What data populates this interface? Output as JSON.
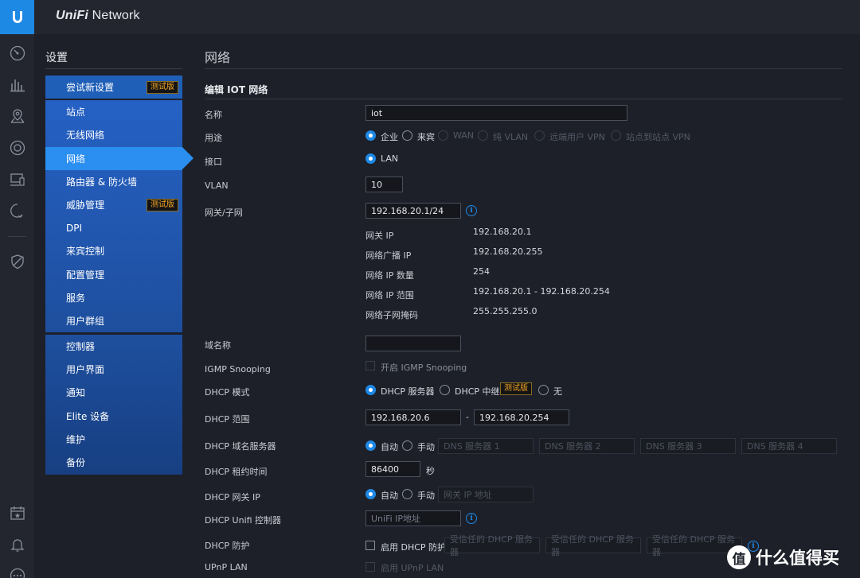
{
  "app": {
    "brand_prefix": "UniFi",
    "brand_suffix": " Network"
  },
  "settings": {
    "title": "设置",
    "try_new": {
      "label": "尝试新设置",
      "badge": "测试版"
    },
    "group1": [
      {
        "label": "站点"
      },
      {
        "label": "无线网络"
      },
      {
        "label": "网络",
        "active": true
      },
      {
        "label": "路由器 & 防火墙"
      },
      {
        "label": "威胁管理",
        "badge": "测试版"
      },
      {
        "label": "DPI"
      },
      {
        "label": "来宾控制"
      },
      {
        "label": "配置管理"
      },
      {
        "label": "服务"
      },
      {
        "label": "用户群组"
      }
    ],
    "group2": [
      {
        "label": "控制器"
      },
      {
        "label": "用户界面"
      },
      {
        "label": "通知"
      },
      {
        "label": "Elite 设备"
      },
      {
        "label": "维护"
      },
      {
        "label": "备份"
      }
    ]
  },
  "page": {
    "title": "网络",
    "section": "编辑 IOT 网络"
  },
  "form": {
    "name": {
      "label": "名称",
      "value": "iot"
    },
    "purpose": {
      "label": "用途",
      "options": [
        "企业",
        "来宾",
        "WAN",
        "纯 VLAN",
        "远端用户 VPN",
        "站点到站点 VPN"
      ],
      "selected": "企业"
    },
    "interface": {
      "label": "接口",
      "value": "LAN"
    },
    "vlan": {
      "label": "VLAN",
      "value": "10"
    },
    "gateway": {
      "label": "网关/子网",
      "value": "192.168.20.1/24",
      "details": [
        {
          "label": "网关 IP",
          "value": "192.168.20.1"
        },
        {
          "label": "网络广播 IP",
          "value": "192.168.20.255"
        },
        {
          "label": "网络 IP 数量",
          "value": "254"
        },
        {
          "label": "网络 IP 范围",
          "value": "192.168.20.1 - 192.168.20.254"
        },
        {
          "label": "网络子网掩码",
          "value": "255.255.255.0"
        }
      ]
    },
    "domain": {
      "label": "域名称",
      "value": ""
    },
    "igmp": {
      "label": "IGMP Snooping",
      "checkbox": "开启 IGMP Snooping"
    },
    "dhcp_mode": {
      "label": "DHCP 模式",
      "options": [
        "DHCP 服务器",
        "DHCP 中继",
        "无"
      ],
      "badge": "测试版",
      "selected": "DHCP 服务器"
    },
    "dhcp_range": {
      "label": "DHCP 范围",
      "start": "192.168.20.6",
      "sep": "-",
      "end": "192.168.20.254"
    },
    "dhcp_dns": {
      "label": "DHCP 域名服务器",
      "options": [
        "自动",
        "手动"
      ],
      "selected": "自动",
      "placeholders": [
        "DNS 服务器 1",
        "DNS 服务器 2",
        "DNS 服务器 3",
        "DNS 服务器 4"
      ]
    },
    "dhcp_lease": {
      "label": "DHCP 租约时间",
      "value": "86400",
      "unit": "秒"
    },
    "dhcp_gateway": {
      "label": "DHCP 网关 IP",
      "options": [
        "自动",
        "手动"
      ],
      "selected": "自动",
      "placeholder": "网关 IP 地址"
    },
    "dhcp_unifi": {
      "label": "DHCP Unifi 控制器",
      "placeholder": "UniFi IP地址"
    },
    "dhcp_guard": {
      "label": "DHCP 防护",
      "checkbox": "启用 DHCP 防护",
      "placeholders": [
        "受信任的 DHCP 服务器",
        "受信任的 DHCP 服务器",
        "受信任的 DHCP 服务器"
      ]
    },
    "upnp": {
      "label": "UPnP LAN",
      "checkbox": "启用 UPnP LAN"
    }
  },
  "watermark": {
    "icon": "值",
    "text": "什么值得买"
  },
  "colors": {
    "accent": "#1e88e5",
    "menu_bg": "#1f5fb8",
    "menu_active": "#2a8ff0",
    "badge": "#f5a623"
  }
}
